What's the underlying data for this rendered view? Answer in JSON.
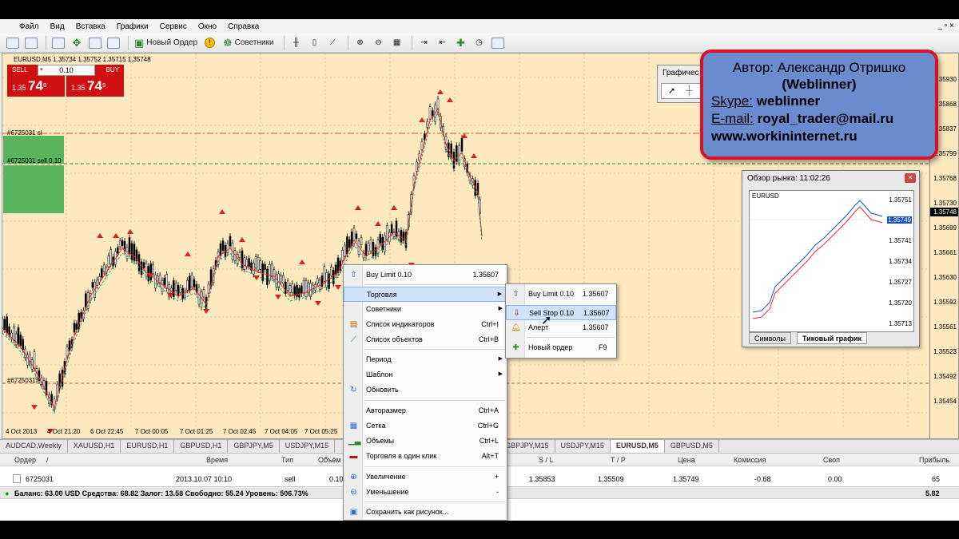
{
  "menubar": {
    "items": [
      "Файл",
      "Вид",
      "Вставка",
      "Графики",
      "Сервис",
      "Окно",
      "Справка"
    ],
    "window_controls": "_ ▫ ×"
  },
  "toolbar": {
    "new_order": "Новый Ордер",
    "advisors": "Советники"
  },
  "chart": {
    "title": "EURUSD,M5  1.35734 1.35752 1.35715 1.35748",
    "sell_label": "SELL",
    "buy_label": "BUY",
    "lot": "0.10",
    "sell_price_small": "1.35",
    "sell_price_big": "74",
    "sell_price_sup": "8",
    "buy_price_small": "1.35",
    "buy_price_big": "74",
    "buy_price_sup": "9",
    "sl_label": "#6725031 sl",
    "order_label": "#6725031 sell 0.10",
    "open_label": "#6725031",
    "current_price": "1.35748",
    "price_ticks": [
      "35930",
      "1.35868",
      "1.35837",
      "1.35799",
      "1.35768",
      "1.35730",
      "1.35699",
      "1.35661",
      "1.35630",
      "1.35592",
      "1.35561",
      "1.35523",
      "1.35492",
      "1.35454"
    ],
    "time_ticks": [
      "4 Oct 2013",
      "4 Oct 21:20",
      "6 Oct 22:45",
      "7 Oct 00:05",
      "7 Oct 01:25",
      "7 Oct 02:45",
      "7 Oct 04:05",
      "7 Oct 05:25"
    ]
  },
  "drawbar": {
    "caption": "Графичес"
  },
  "author": {
    "line1": "Автор: Александр Отришко",
    "line2": "(Weblinner)",
    "skype_label": "Skype:",
    "skype_value": "weblinner",
    "email_label": "E-mail:",
    "email_value": "royal_trader@mail.ru",
    "site": "www.workininternet.ru"
  },
  "market_watch": {
    "caption": "Обзор рынка: 11:02:26",
    "symbol": "EURUSD",
    "ticks": [
      "1.35751",
      "1.35749",
      "1.35741",
      "1.35734",
      "1.35727",
      "1.35720",
      "1.35713"
    ],
    "tab_symbols": "Символы",
    "tab_tick": "Тиковый график"
  },
  "context_menu": {
    "items": [
      {
        "label": "Buy Limit 0.10",
        "key": "1.35607"
      },
      {
        "label": "Торговля",
        "key": ""
      },
      {
        "label": "Советники",
        "key": ""
      },
      {
        "label": "Список индикаторов",
        "key": "Ctrl+I"
      },
      {
        "label": "Список объектов",
        "key": "Ctrl+B"
      },
      {
        "label": "Период",
        "key": ""
      },
      {
        "label": "Шаблон",
        "key": ""
      },
      {
        "label": "Обновить",
        "key": ""
      },
      {
        "label": "Авторазмер",
        "key": "Ctrl+A"
      },
      {
        "label": "Сетка",
        "key": "Ctrl+G"
      },
      {
        "label": "Объемы",
        "key": "Ctrl+L"
      },
      {
        "label": "Торговля в один клик",
        "key": "Alt+T"
      },
      {
        "label": "Увеличение",
        "key": "+"
      },
      {
        "label": "Уменьшение",
        "key": "-"
      },
      {
        "label": "Сохранить как рисунок...",
        "key": ""
      }
    ]
  },
  "submenu": {
    "items": [
      {
        "label": "Buy Limit 0.10",
        "key": "1.35607"
      },
      {
        "label": "Sell Stop 0.10",
        "key": "1.35607"
      },
      {
        "label": "Алерт",
        "key": "1.35607"
      },
      {
        "label": "Новый ордер",
        "key": "F9"
      }
    ]
  },
  "tabs": [
    "AUDCAD,Weekly",
    "XAUUSD,H1",
    "EURUSD,H1",
    "GBPUSD,H1",
    "GBPJPY,M5",
    "USDJPY,M15",
    "GBPJPY,M15",
    "USDJPY,M15",
    "EURUSD,M5",
    "GBPUSD,M5"
  ],
  "terminal": {
    "headers": {
      "order": "Ордер",
      "sort": "/",
      "time": "Время",
      "type": "Тип",
      "volume": "Объём",
      "sl": "S / L",
      "tp": "T / P",
      "price": "Цена",
      "commission": "Комиссия",
      "swap": "Своп",
      "profit": "Прибыль"
    },
    "row": {
      "order": "6725031",
      "time": "2013.10.07 10:10",
      "type": "sell",
      "volume": "0.10",
      "sl": "1.35853",
      "tp": "1.35509",
      "price": "1.35749",
      "commission": "-0.68",
      "swap": "0.00",
      "profit": "65"
    },
    "balance": "Баланс: 63.00 USD  Средства: 68.82  Залог: 13.58  Свободно: 55.24  Уровень: 506.73%",
    "balance_profit": "5.82"
  }
}
